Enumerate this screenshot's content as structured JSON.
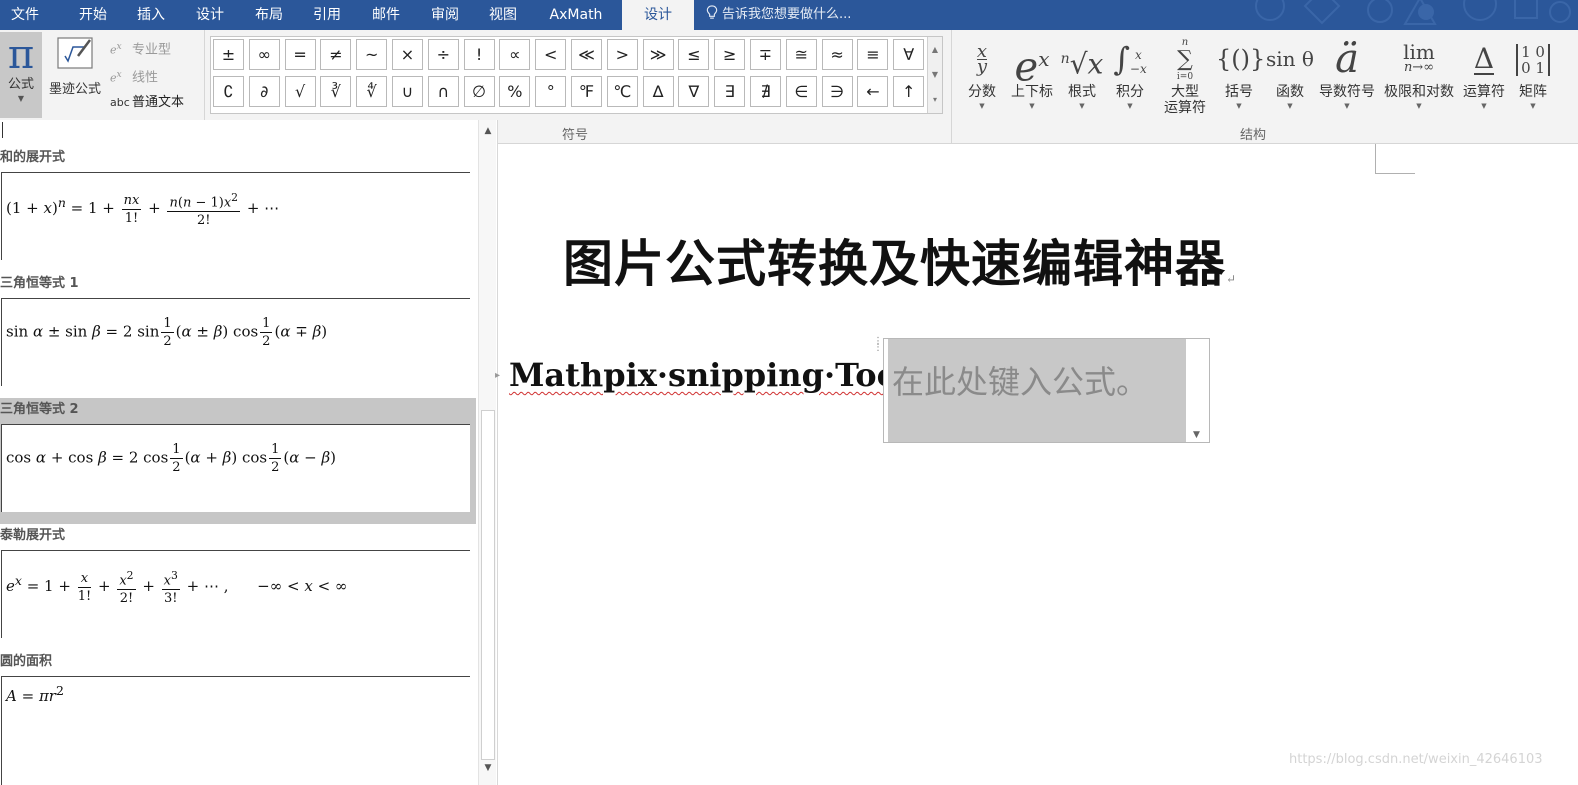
{
  "colors": {
    "menubar_bg": "#2b579a",
    "ribbon_bg": "#f3f3f3",
    "selected_gallery_bg": "#c6c6c6",
    "equation_placeholder_bg": "#c8c8c8"
  },
  "menubar": {
    "tabs": [
      {
        "label": "文件"
      },
      {
        "label": "开始"
      },
      {
        "label": "插入"
      },
      {
        "label": "设计"
      },
      {
        "label": "布局"
      },
      {
        "label": "引用"
      },
      {
        "label": "邮件"
      },
      {
        "label": "审阅"
      },
      {
        "label": "视图"
      },
      {
        "label": "AxMath"
      },
      {
        "label": "设计",
        "active": true
      }
    ],
    "tell_me": "告诉我您想要做什么..."
  },
  "ribbon": {
    "tools": {
      "formula_icon": "π",
      "formula_label": "公式",
      "ink_label": "墨迹公式",
      "professional_label": "专业型",
      "linear_label": "线性",
      "normal_text_icon": "abc",
      "normal_text_label": "普通文本"
    },
    "symbols": {
      "group_label": "符号",
      "row1": [
        "±",
        "∞",
        "=",
        "≠",
        "~",
        "×",
        "÷",
        "!",
        "∝",
        "<",
        "≪",
        ">",
        "≫",
        "≤",
        "≥",
        "∓",
        "≅",
        "≈",
        "≡",
        "∀"
      ],
      "row2": [
        "∁",
        "∂",
        "√",
        "∛",
        "∜",
        "∪",
        "∩",
        "∅",
        "%",
        "°",
        "℉",
        "℃",
        "∆",
        "∇",
        "∃",
        "∄",
        "∈",
        "∋",
        "←",
        "↑"
      ]
    },
    "structures": {
      "group_label": "结构",
      "items": [
        {
          "label": "分数"
        },
        {
          "label": "上下标"
        },
        {
          "label": "根式"
        },
        {
          "label": "积分"
        },
        {
          "label": "大型\n运算符"
        },
        {
          "label": "括号"
        },
        {
          "label": "函数"
        },
        {
          "label": "导数符号"
        },
        {
          "label": "极限和对数"
        },
        {
          "label": "运算符"
        },
        {
          "label": "矩阵"
        }
      ]
    }
  },
  "gallery": {
    "items": [
      {
        "title": "和的展开式"
      },
      {
        "title": "三角恒等式 1"
      },
      {
        "title": "三角恒等式 2"
      },
      {
        "title": "泰勒展开式"
      },
      {
        "title": "圆的面积"
      }
    ]
  },
  "document": {
    "title": "图片公式转换及快速编辑神器",
    "line_text": "Mathpix·snipping·Tool",
    "equation_placeholder": "在此处键入公式。",
    "watermark": "https://blog.csdn.net/weixin_42646103"
  }
}
